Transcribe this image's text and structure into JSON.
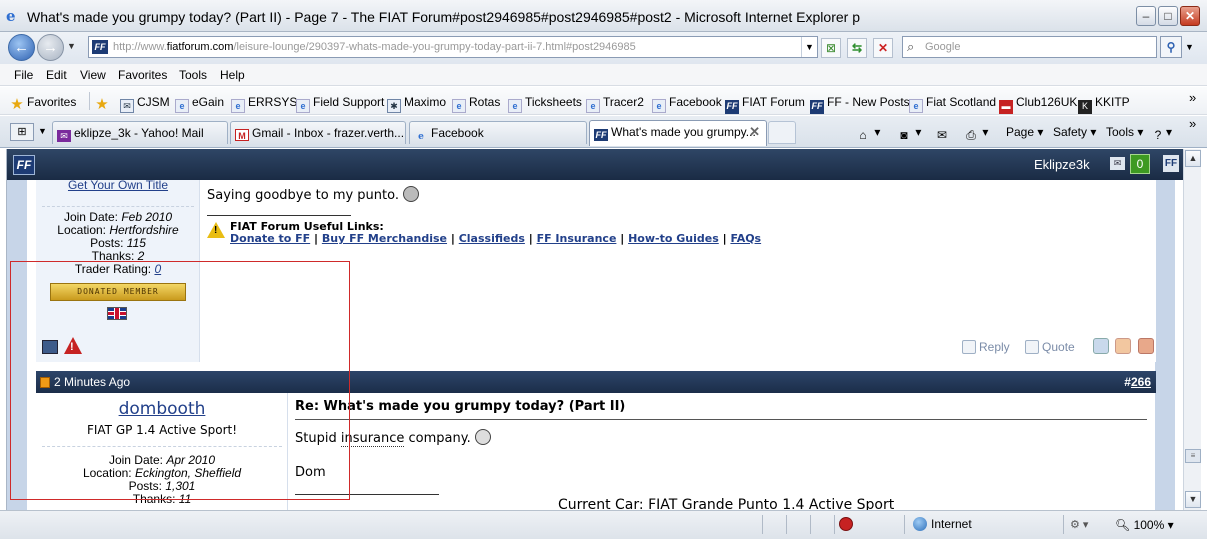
{
  "window": {
    "title": "What's made you grumpy today? (Part II) - Page 7 - The FIAT Forum#post2946985#post2946985#post2 - Microsoft Internet Explorer p"
  },
  "address": {
    "url_prefix": "http://www.",
    "url_domain": "fiatforum.com",
    "url_path": "/leisure-lounge/290397-whats-made-you-grumpy-today-part-ii-7.html#post2946985",
    "search_placeholder": "Google"
  },
  "menu": [
    "File",
    "Edit",
    "View",
    "Favorites",
    "Tools",
    "Help"
  ],
  "favorites": {
    "label": "Favorites",
    "items": [
      "CJSM",
      "eGain",
      "ERRSYS",
      "Field Support",
      "Maximo",
      "Rotas",
      "Ticksheets",
      "Tracer2",
      "Facebook",
      "FIAT Forum",
      "FF - New Posts",
      "Fiat Scotland",
      "Club126UK",
      "KKITP"
    ]
  },
  "tabs": [
    {
      "label": "eklipze_3k - Yahoo! Mail"
    },
    {
      "label": "Gmail - Inbox - frazer.verth..."
    },
    {
      "label": "Facebook"
    },
    {
      "label": "What's made you grumpy..."
    }
  ],
  "commands": {
    "page": "Page",
    "safety": "Safety",
    "tools": "Tools"
  },
  "site": {
    "username": "Eklipze3k",
    "notification_count": "0"
  },
  "post1": {
    "get_title": "Get Your Own Title",
    "join_label": "Join Date:",
    "join_date": "Feb 2010",
    "location_label": "Location:",
    "location": "Hertfordshire",
    "posts_label": "Posts:",
    "posts": "115",
    "thanks_label": "Thanks:",
    "thanks": "2",
    "trader_label": "Trader Rating:",
    "trader_rating": "0",
    "badge": "DONATED MEMBER",
    "text": "Saying goodbye to my punto.",
    "useful_title": "FIAT Forum Useful Links:",
    "links": [
      "Donate to FF",
      "Buy FF Merchandise",
      "Classifieds",
      "FF Insurance",
      "How-to Guides",
      "FAQs"
    ],
    "reply": "Reply",
    "quote": "Quote"
  },
  "post2": {
    "date": "2 Minutes Ago",
    "number_prefix": "#",
    "number": "266",
    "username": "dombooth",
    "user_title": "FIAT GP 1.4 Active Sport!",
    "join_label": "Join Date:",
    "join_date": "Apr 2010",
    "location_label": "Location:",
    "location": "Eckington, Sheffield",
    "posts_label": "Posts:",
    "posts": "1,301",
    "thanks_label": "Thanks:",
    "thanks": "11",
    "title": "Re: What's made you grumpy today? (Part II)",
    "text_before": "Stupid ",
    "text_word": "insurance",
    "text_after": " company.",
    "signoff": "Dom",
    "current_car": "Current Car: FIAT Grande Punto 1.4 Active Sport"
  },
  "status": {
    "zone": "Internet",
    "zoom": "100%"
  }
}
